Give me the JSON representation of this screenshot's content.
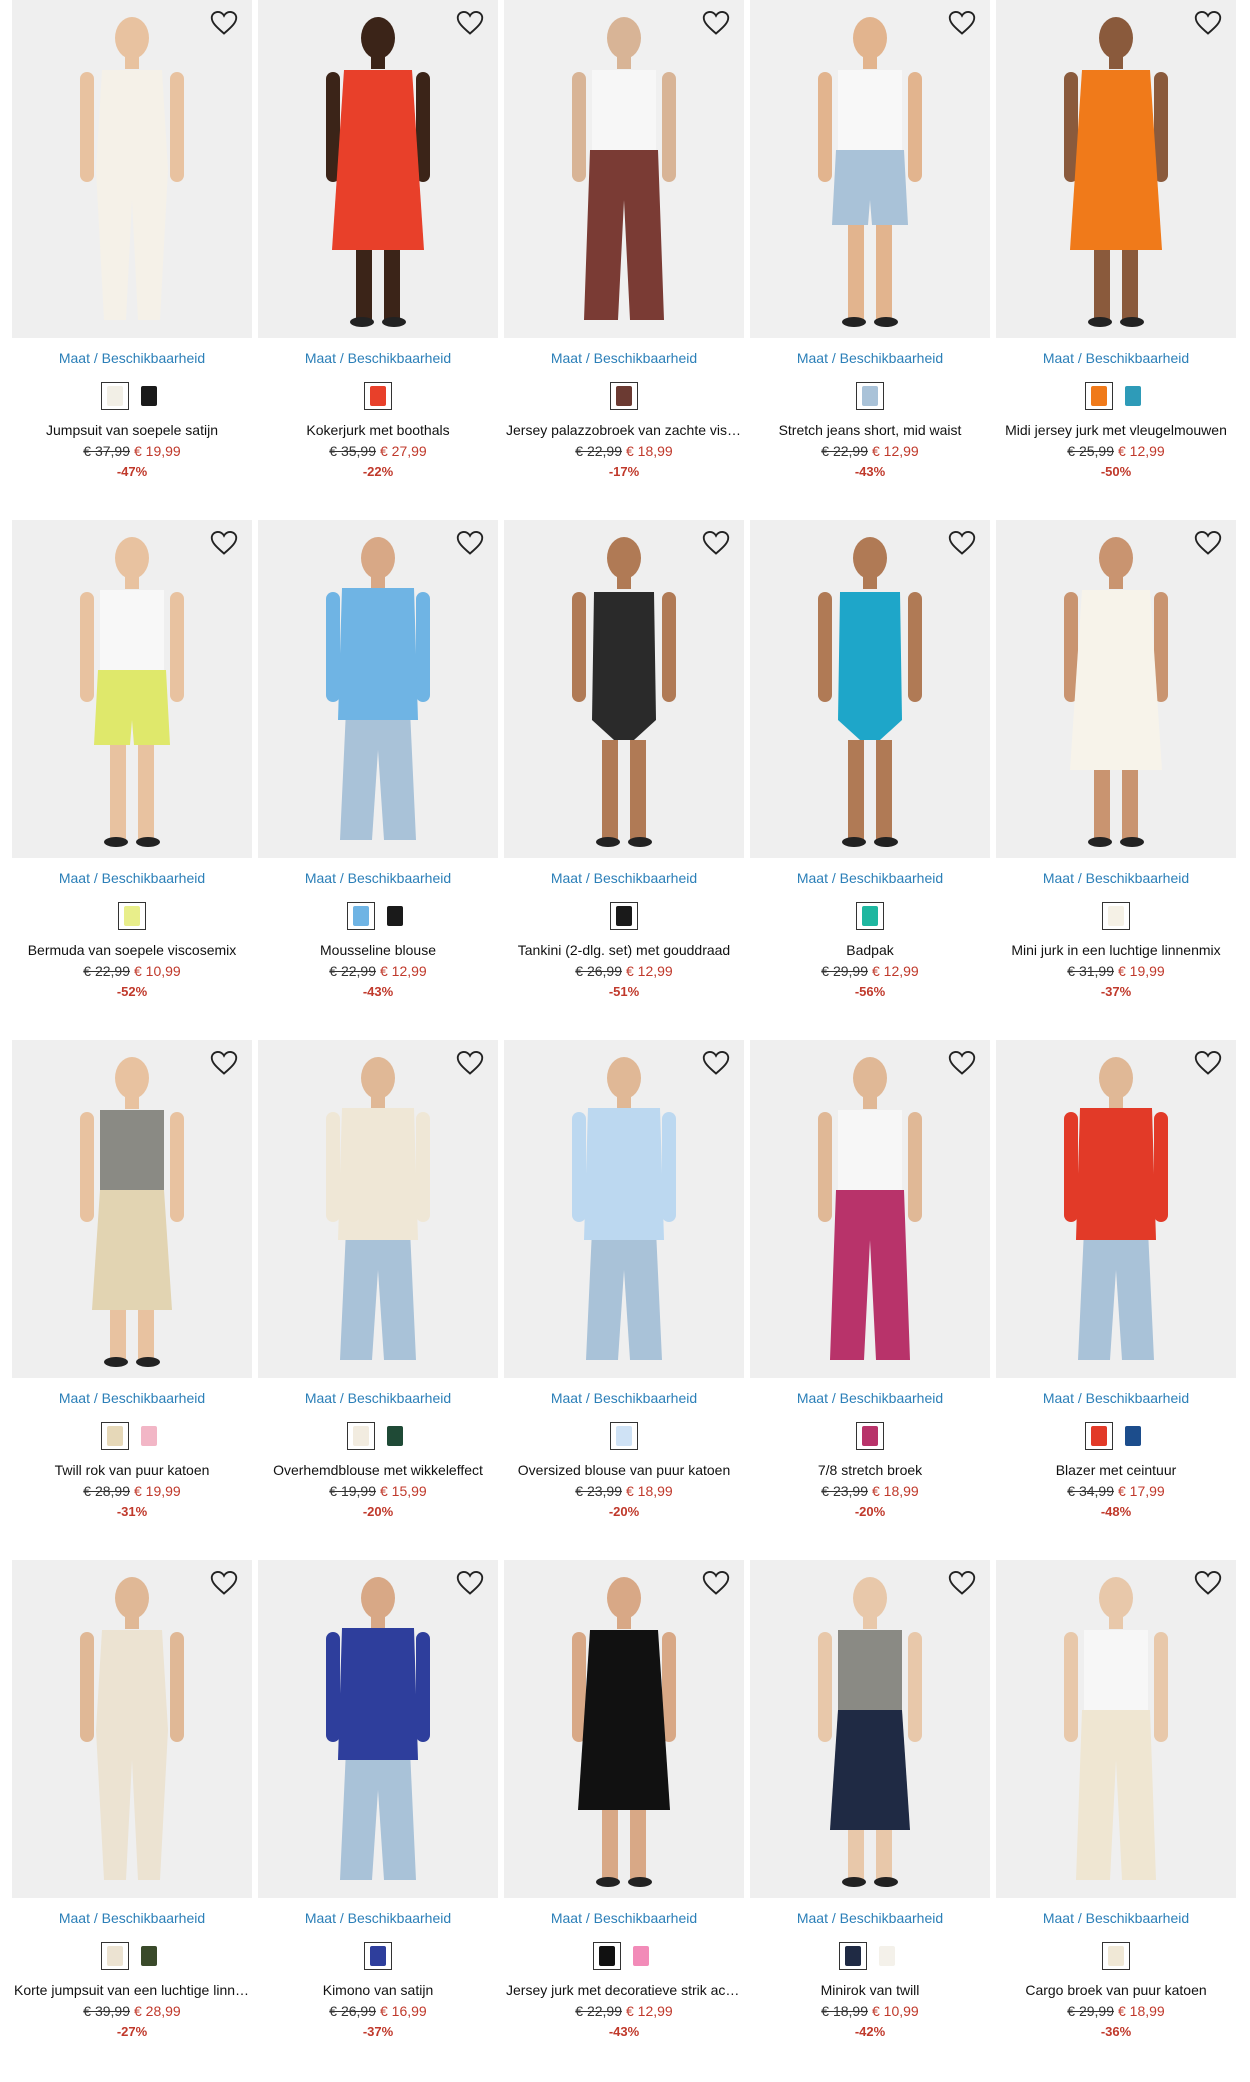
{
  "size_link_label": "Maat / Beschikbaarheid",
  "icons": {
    "wishlist": "heart-outline-icon"
  },
  "colors": {
    "link": "#2b7fb8",
    "sale": "#c0392b"
  },
  "products": [
    {
      "title": "Jumpsuit van soepele satijn",
      "old_price": "€ 37,99",
      "new_price": "€ 19,99",
      "discount": "-47%",
      "bg": "#efefef",
      "garment": "#f5f1e8",
      "skin": "#e8c2a0",
      "swatches": [
        "#f2efe6",
        "#1a1a1a"
      ],
      "shape": "jumpsuit"
    },
    {
      "title": "Kokerjurk met boothals",
      "old_price": "€ 35,99",
      "new_price": "€ 27,99",
      "discount": "-22%",
      "bg": "#efefef",
      "garment": "#e8402a",
      "skin": "#3b2418",
      "swatches": [
        "#e8402a"
      ],
      "shape": "dress"
    },
    {
      "title": "Jersey palazzobroek van zachte viscose",
      "old_price": "€ 22,99",
      "new_price": "€ 18,99",
      "discount": "-17%",
      "bg": "#f0f0f0",
      "garment": "#7a3b34",
      "skin": "#d8b496",
      "swatches": [
        "#6b3a32"
      ],
      "shape": "pants"
    },
    {
      "title": "Stretch jeans short, mid waist",
      "old_price": "€ 22,99",
      "new_price": "€ 12,99",
      "discount": "-43%",
      "bg": "#f0f0f0",
      "garment": "#a9c2d8",
      "skin": "#e2b48e",
      "swatches": [
        "#a9c2d8"
      ],
      "shape": "shorts"
    },
    {
      "title": "Midi jersey jurk met vleugelmouwen",
      "old_price": "€ 25,99",
      "new_price": "€ 12,99",
      "discount": "-50%",
      "bg": "#efefef",
      "garment": "#f07a1a",
      "skin": "#8a5a3c",
      "swatches": [
        "#f07a1a",
        "#2e9bb8"
      ],
      "shape": "dress"
    },
    {
      "title": "Bermuda van soepele viscosemix",
      "old_price": "€ 22,99",
      "new_price": "€ 10,99",
      "discount": "-52%",
      "bg": "#efefef",
      "garment": "#dfe86b",
      "skin": "#e8c2a0",
      "swatches": [
        "#e8ee8a"
      ],
      "shape": "shorts"
    },
    {
      "title": "Mousseline blouse",
      "old_price": "€ 22,99",
      "new_price": "€ 12,99",
      "discount": "-43%",
      "bg": "#efefef",
      "garment": "#6fb4e4",
      "skin": "#d8a886",
      "swatches": [
        "#6fb4e4",
        "#1a1a1a"
      ],
      "shape": "top"
    },
    {
      "title": "Tankini (2-dlg. set) met gouddraad",
      "old_price": "€ 26,99",
      "new_price": "€ 12,99",
      "discount": "-51%",
      "bg": "#efefef",
      "garment": "#2a2a2a",
      "skin": "#b07a55",
      "swatches": [
        "#1a1a1a"
      ],
      "shape": "swim"
    },
    {
      "title": "Badpak",
      "old_price": "€ 29,99",
      "new_price": "€ 12,99",
      "discount": "-56%",
      "bg": "#efefef",
      "garment": "#1ea6c9",
      "skin": "#b07a55",
      "swatches": [
        "#1eb7a0"
      ],
      "shape": "swim"
    },
    {
      "title": "Mini jurk in een luchtige linnenmix",
      "old_price": "€ 31,99",
      "new_price": "€ 19,99",
      "discount": "-37%",
      "bg": "#efefef",
      "garment": "#f7f3ea",
      "skin": "#c99470",
      "swatches": [
        "#f5f1e6"
      ],
      "shape": "dress"
    },
    {
      "title": "Twill rok van puur katoen",
      "old_price": "€ 28,99",
      "new_price": "€ 19,99",
      "discount": "-31%",
      "bg": "#efefef",
      "garment": "#e2d4b2",
      "skin": "#e8c2a0",
      "swatches": [
        "#e6d8b8",
        "#f2b6c6"
      ],
      "shape": "skirt"
    },
    {
      "title": "Overhemdblouse met wikkeleffect",
      "old_price": "€ 19,99",
      "new_price": "€ 15,99",
      "discount": "-20%",
      "bg": "#efefef",
      "garment": "#efe7d6",
      "skin": "#e0b896",
      "swatches": [
        "#f2ece0",
        "#1f4a36"
      ],
      "shape": "top"
    },
    {
      "title": "Oversized blouse van puur katoen",
      "old_price": "€ 23,99",
      "new_price": "€ 18,99",
      "discount": "-20%",
      "bg": "#efefef",
      "garment": "#bcd8f0",
      "skin": "#e0b896",
      "swatches": [
        "#cfe2f5"
      ],
      "shape": "top"
    },
    {
      "title": "7/8 stretch broek",
      "old_price": "€ 23,99",
      "new_price": "€ 18,99",
      "discount": "-20%",
      "bg": "#efefef",
      "garment": "#b8336a",
      "skin": "#e0b896",
      "swatches": [
        "#b8336a"
      ],
      "shape": "pants"
    },
    {
      "title": "Blazer met ceintuur",
      "old_price": "€ 34,99",
      "new_price": "€ 17,99",
      "discount": "-48%",
      "bg": "#efefef",
      "garment": "#e23a28",
      "skin": "#e0b896",
      "swatches": [
        "#e23a28",
        "#1c4d8c"
      ],
      "shape": "top"
    },
    {
      "title": "Korte jumpsuit van een luchtige linnenmix",
      "old_price": "€ 39,99",
      "new_price": "€ 28,99",
      "discount": "-27%",
      "bg": "#efefef",
      "garment": "#ece3d2",
      "skin": "#e0b896",
      "swatches": [
        "#ece3d2",
        "#3a4a2a"
      ],
      "shape": "jumpsuit"
    },
    {
      "title": "Kimono van satijn",
      "old_price": "€ 26,99",
      "new_price": "€ 16,99",
      "discount": "-37%",
      "bg": "#efefef",
      "garment": "#2e3e9c",
      "skin": "#d8a886",
      "swatches": [
        "#2e3e9c"
      ],
      "shape": "top"
    },
    {
      "title": "Jersey jurk met decoratieve strik achter",
      "old_price": "€ 22,99",
      "new_price": "€ 12,99",
      "discount": "-43%",
      "bg": "#efefef",
      "garment": "#111111",
      "skin": "#d8a886",
      "swatches": [
        "#111111",
        "#f28bb8"
      ],
      "shape": "dress"
    },
    {
      "title": "Minirok van twill",
      "old_price": "€ 18,99",
      "new_price": "€ 10,99",
      "discount": "-42%",
      "bg": "#efefef",
      "garment": "#1f2a44",
      "skin": "#e8c8aa",
      "swatches": [
        "#1f2a44",
        "#f4f1ea"
      ],
      "shape": "skirt"
    },
    {
      "title": "Cargo broek van puur katoen",
      "old_price": "€ 29,99",
      "new_price": "€ 18,99",
      "discount": "-36%",
      "bg": "#efefef",
      "garment": "#efe6d2",
      "skin": "#e8c8aa",
      "swatches": [
        "#f0e8d6"
      ],
      "shape": "pants"
    }
  ]
}
